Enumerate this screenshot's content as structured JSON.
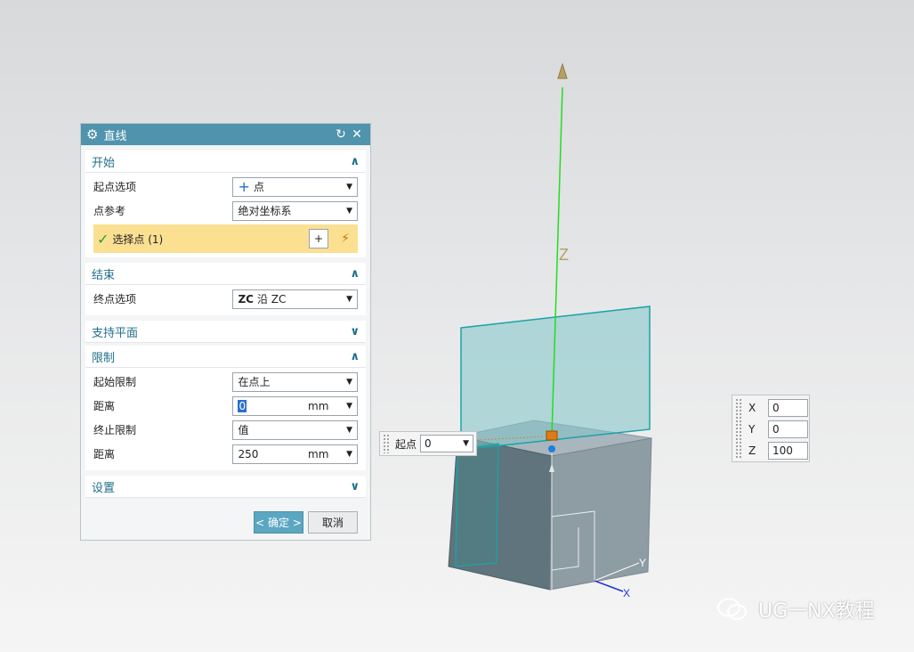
{
  "dialog": {
    "title": "直线",
    "sections": {
      "start": {
        "label": "开始",
        "start_option_label": "起点选项",
        "start_option_value": "点",
        "point_ref_label": "点参考",
        "point_ref_value": "绝对坐标系",
        "select_point_label": "选择点 (1)"
      },
      "end": {
        "label": "结束",
        "end_option_label": "终点选项",
        "end_option_value": "沿 ZC",
        "end_option_prefix": "ZC"
      },
      "support_plane": {
        "label": "支持平面"
      },
      "limits": {
        "label": "限制",
        "start_limit_label": "起始限制",
        "start_limit_value": "在点上",
        "distance1_label": "距离",
        "distance1_value": "0",
        "distance1_unit": "mm",
        "end_limit_label": "终止限制",
        "end_limit_value": "值",
        "distance2_label": "距离",
        "distance2_value": "250",
        "distance2_unit": "mm"
      },
      "settings": {
        "label": "设置"
      }
    },
    "ok_label": "< 确定 >",
    "cancel_label": "取消"
  },
  "start_widget": {
    "label": "起点",
    "value": "0"
  },
  "xyz_widget": {
    "x_label": "X",
    "x_value": "0",
    "y_label": "Y",
    "y_value": "0",
    "z_label": "Z",
    "z_value": "100"
  },
  "viewport": {
    "z_axis_label": "Z",
    "x_axis_label": "X",
    "y_axis_label": "Y"
  },
  "watermark": {
    "text": "UG一NX教程"
  },
  "colors": {
    "title_bar": "#4f93ad",
    "accent": "#1f6f8b",
    "selection_highlight": "#fbe092",
    "line_green": "#22dd22",
    "plane": "#7fc4c9"
  }
}
